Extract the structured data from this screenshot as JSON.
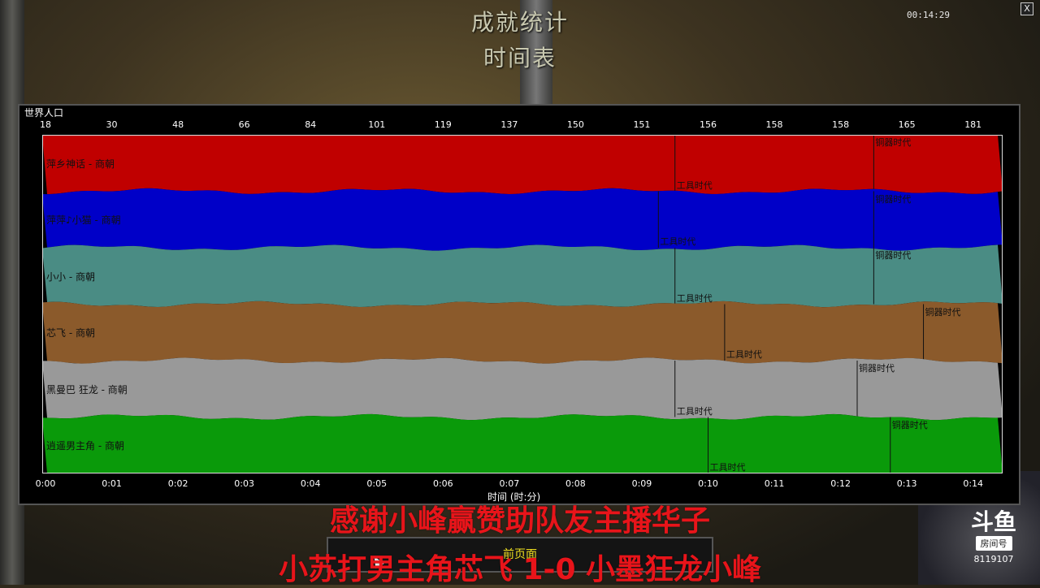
{
  "header": {
    "title": "成就统计",
    "subtitle": "时间表",
    "clock": "00:14:29",
    "close_label": "X"
  },
  "chart_data": {
    "type": "area",
    "title": "世界人口",
    "top_ticks": [
      "18",
      "30",
      "48",
      "66",
      "84",
      "101",
      "119",
      "137",
      "150",
      "151",
      "156",
      "158",
      "158",
      "165",
      "181"
    ],
    "x_ticks": [
      "0:00",
      "0:01",
      "0:02",
      "0:03",
      "0:04",
      "0:05",
      "0:06",
      "0:07",
      "0:08",
      "0:09",
      "0:10",
      "0:11",
      "0:12",
      "0:13",
      "0:14"
    ],
    "xlabel": "时间 (时:分)",
    "series": [
      {
        "name": "萍乡神话 - 商朝",
        "color": "#c00000",
        "tool_age": 9.5,
        "bronze_age": 12.5
      },
      {
        "name": "萍萍♪小猫 - 商朝",
        "color": "#0000c8",
        "tool_age": 9.25,
        "bronze_age": 12.5
      },
      {
        "name": "小小 - 商朝",
        "color": "#4a8c84",
        "tool_age": 9.5,
        "bronze_age": 12.5
      },
      {
        "name": "芯飞 - 商朝",
        "color": "#8b5a2b",
        "tool_age": 10.25,
        "bronze_age": 13.25
      },
      {
        "name": "黑曼巴 狂龙 - 商朝",
        "color": "#999999",
        "tool_age": 9.5,
        "bronze_age": 12.25
      },
      {
        "name": "逍遥男主角 - 商朝",
        "color": "#0a9a0a",
        "tool_age": 10.0,
        "bronze_age": 12.75
      }
    ],
    "tool_label": "工具时代",
    "bronze_label": "铜器时代"
  },
  "overlay": {
    "line1": "感谢小峰赢赞助队友主播华子",
    "line2": "小苏打男主角芯飞 1-0 小墨狂龙小峰"
  },
  "back_button": "前页面",
  "logo": {
    "glyph": "斗鱼",
    "room": "房间号",
    "number": "8119107"
  }
}
